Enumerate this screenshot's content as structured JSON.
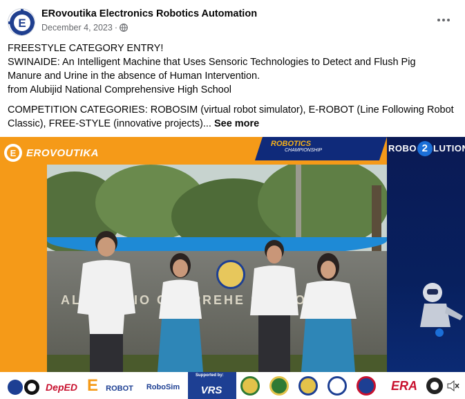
{
  "post": {
    "page_name": "ERovoutika Electronics Robotics Automation",
    "date": "December 4, 2023",
    "separator": "·",
    "audience_icon": "globe-icon",
    "more_icon": "more-horizontal-icon",
    "text_lines": [
      "FREESTYLE CATEGORY ENTRY!",
      "SWINAIDE: An Intelligent Machine that Uses Sensoric Technologies to Detect and Flush Pig",
      "Manure and Urine in the absence of Human Intervention.",
      "from Alubijid National Comprehensive High School"
    ],
    "categories_line_1": "COMPETITION CATEGORIES: ROBOSIM (virtual robot simulator),  E-ROBOT (Line Following Robot",
    "categories_line_2": "Classic), FREE-STYLE (innovative projects)...",
    "see_more": "See more"
  },
  "video": {
    "brand_logo_text": "EROVOUTIKA",
    "championship_title": "ROBOTICS",
    "championship_sub": "CHAMPIONSHIP",
    "robo_title_left": "ROBO",
    "robo_title_num": "2",
    "robo_title_right": "LUTION",
    "wall_text": "ALUBI  ATIO  COMPREHE        SCHOOL",
    "supported_by": "Supported by:",
    "sponsors": [
      "DepED",
      "E",
      "ROBOT",
      "RoboSim",
      "VRS",
      "ERA"
    ],
    "colors": {
      "frame_orange": "#f59a18",
      "panel_navy": "#0a1a55",
      "accent_blue": "#1e8ad6"
    }
  }
}
